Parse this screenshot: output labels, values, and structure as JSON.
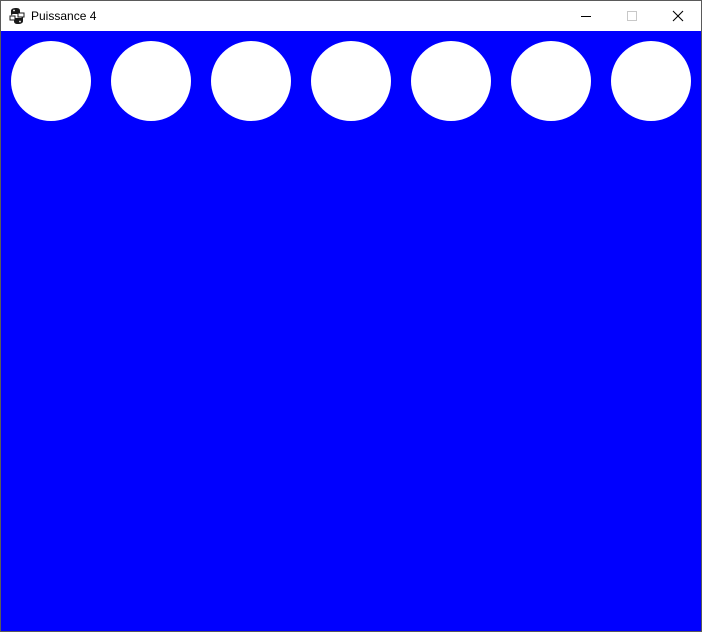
{
  "window": {
    "title": "Puissance 4",
    "icon": "python-icon"
  },
  "controls": {
    "minimize_icon": "minimize-icon",
    "maximize_icon": "maximize-icon",
    "close_icon": "close-icon"
  },
  "board": {
    "background_color": "#0000ff",
    "empty_slot_color": "#ffffff",
    "columns": 7,
    "visible_rows": 1
  }
}
